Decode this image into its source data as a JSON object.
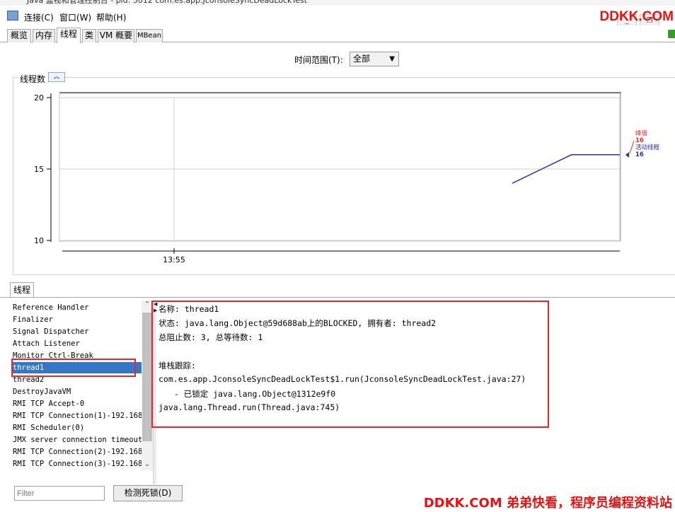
{
  "window": {
    "title": "Java 监视和管理控制台 - pid: 5012 com.es.app.JconsoleSyncDeadLockTest"
  },
  "menu": [
    "连接(C)",
    "窗口(W)",
    "帮助(H)"
  ],
  "watermark_top": "DDKK.COM",
  "tabs": [
    "概览",
    "内存",
    "线程",
    "类",
    "VM 概要",
    "MBean"
  ],
  "active_tab": "线程",
  "time_range": {
    "label": "时间范围(T):",
    "value": "全部"
  },
  "chart_section": {
    "title": "线程数"
  },
  "chart_data": {
    "type": "line",
    "ylim": [
      10,
      20
    ],
    "y_ticks": [
      "20",
      "15",
      "10"
    ],
    "x_ticks": [
      "13:55"
    ],
    "grid": true,
    "series": [
      {
        "name": "峰值",
        "value": "16",
        "color": "#e8262a"
      },
      {
        "name": "活动线程",
        "value": "16",
        "color": "#2a2aa0",
        "points": [
          [
            0.0,
            14.0
          ],
          [
            0.55,
            16.0
          ],
          [
            1.0,
            16.0
          ]
        ]
      }
    ]
  },
  "threads_panel": {
    "tab_label": "线程",
    "threads": [
      "Reference Handler",
      "Finalizer",
      "Signal Dispatcher",
      "Attach Listener",
      "Monitor Ctrl-Break",
      "thread1",
      "thread2",
      "DestroyJavaVM",
      "RMI TCP Accept-0",
      "RMI TCP Connection(1)-192.168.",
      "RMI Scheduler(0)",
      "JMX server connection timeout",
      "RMI TCP Connection(2)-192.168.",
      "RMI TCP Connection(3)-192.168."
    ],
    "selected": "thread1",
    "filter_placeholder": "Filter",
    "detect_button": "检测死锁(D)"
  },
  "thread_detail": {
    "name": "名称: thread1",
    "state": "状态: java.lang.Object@59d688ab上的BLOCKED, 拥有者: thread2",
    "counts": "总阻止数: 3, 总等待数: 1",
    "stack_title": "堆栈跟踪:",
    "stack": [
      "com.es.app.JconsoleSyncDeadLockTest$1.run(JconsoleSyncDeadLockTest.java:27)",
      "  - 已锁定 java.lang.Object@1312e9f0",
      "java.lang.Thread.run(Thread.java:745)"
    ]
  },
  "watermark_bottom": "DDKK.COM 弟弟快看，程序员编程资料站"
}
